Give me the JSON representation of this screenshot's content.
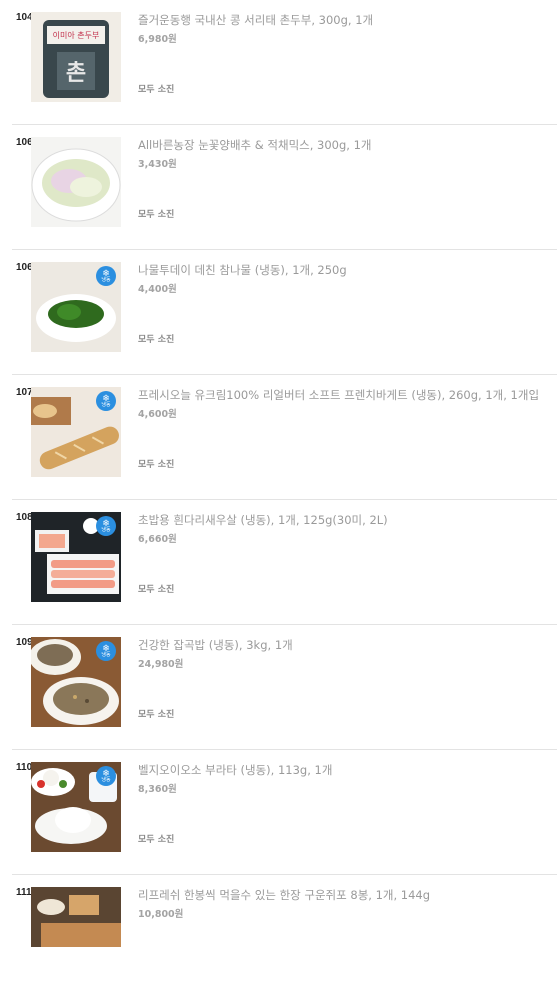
{
  "items": [
    {
      "rank": "104",
      "name": "즐거운동행 국내산 콩 서리태 촌두부, 300g, 1개",
      "price": "6,980원",
      "status": "모두 소진",
      "frozen": false
    },
    {
      "rank": "106",
      "name": "All바른농장 눈꽃양배추 & 적채믹스, 300g, 1개",
      "price": "3,430원",
      "status": "모두 소진",
      "frozen": false
    },
    {
      "rank": "106",
      "name": "나물투데이 데친 참나물 (냉동), 1개, 250g",
      "price": "4,400원",
      "status": "모두 소진",
      "frozen": true
    },
    {
      "rank": "107",
      "name": "프레시오늘 유크림100% 리얼버터 소프트 프렌치바게트 (냉동), 260g, 1개, 1개입",
      "price": "4,600원",
      "status": "모두 소진",
      "frozen": true
    },
    {
      "rank": "108",
      "name": "초밥용 흰다리새우살 (냉동), 1개, 125g(30미, 2L)",
      "price": "6,660원",
      "status": "모두 소진",
      "frozen": true
    },
    {
      "rank": "109",
      "name": "건강한 잡곡밥 (냉동), 3kg, 1개",
      "price": "24,980원",
      "status": "모두 소진",
      "frozen": true
    },
    {
      "rank": "110",
      "name": "벨지오이오소 부라타 (냉동), 113g, 1개",
      "price": "8,360원",
      "status": "모두 소진",
      "frozen": true
    },
    {
      "rank": "111",
      "name": "리프레쉬 한봉씩 먹을수 있는 한장 구운쥐포 8봉, 1개, 144g",
      "price": "10,800원",
      "status": "",
      "frozen": false
    }
  ],
  "frozen_badge": {
    "glyph": "❄",
    "label": "냉동"
  },
  "thumb0_label": "이미아 촌두부",
  "thumb0_mark": "촌"
}
